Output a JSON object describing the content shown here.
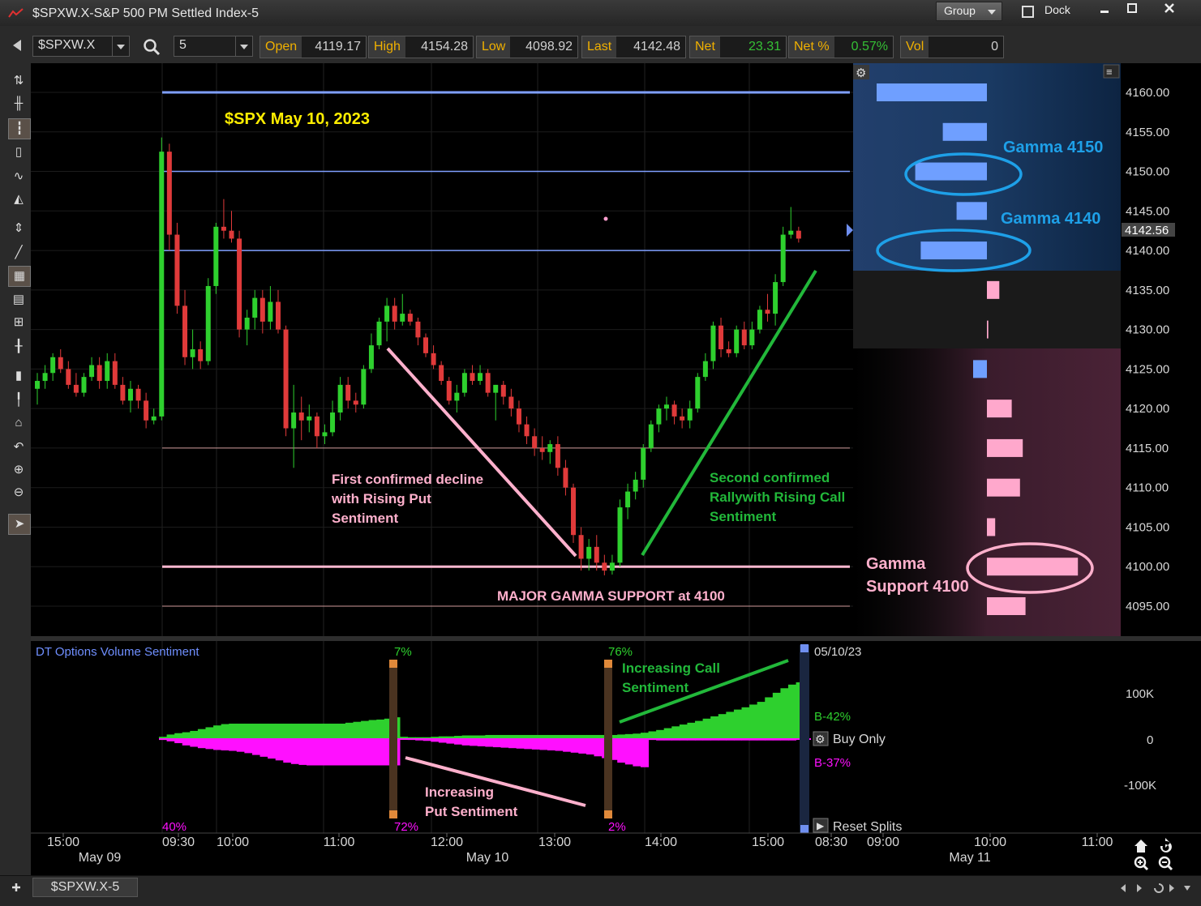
{
  "window": {
    "title": "$SPXW.X-S&P 500 PM Settled Index-5",
    "group_label": "Group",
    "dock_label": "Dock"
  },
  "toolbar": {
    "symbol": "$SPXW.X",
    "interval": "5",
    "quotes": [
      {
        "key": "Open",
        "value": "4119.17"
      },
      {
        "key": "High",
        "value": "4154.28"
      },
      {
        "key": "Low",
        "value": "4098.92"
      },
      {
        "key": "Last",
        "value": "4142.48"
      },
      {
        "key": "Net",
        "value": "23.31"
      },
      {
        "key": "Net %",
        "value": "0.57%"
      },
      {
        "key": "Vol",
        "value": "0"
      }
    ]
  },
  "chart": {
    "heading": "$SPX May 10, 2023",
    "price_axis_labels": [
      "4160.00",
      "4155.00",
      "4150.00",
      "4145.00",
      "4140.00",
      "4135.00",
      "4130.00",
      "4125.00",
      "4120.00",
      "4115.00",
      "4110.00",
      "4105.00",
      "4100.00",
      "4095.00"
    ],
    "current_price": "4142.56",
    "annotations": {
      "gamma_4150": "Gamma 4150",
      "gamma_4140": "Gamma 4140",
      "gamma_support_line1": "Gamma",
      "gamma_support_line2": "Support 4100",
      "decline_line1": "First confirmed decline",
      "decline_line2": "with Rising Put",
      "decline_line3": "Sentiment",
      "rally_line1": "Second confirmed",
      "rally_line2": "Rallywith Rising Call",
      "rally_line3": "Sentiment",
      "major_support": "MAJOR GAMMA SUPPORT at 4100"
    }
  },
  "indicator": {
    "title": "DT Options Volume Sentiment",
    "axis_labels": [
      "100K",
      "0",
      "-100K"
    ],
    "date_label": "05/10/23",
    "b_green": "B-42%",
    "b_magenta": "B-37%",
    "buy_only": "Buy Only",
    "reset_splits": "Reset Splits",
    "split_top": [
      "7%",
      "76%"
    ],
    "split_bottom": [
      "40%",
      "72%",
      "2%"
    ],
    "call_annotation_line1": "Increasing Call",
    "call_annotation_line2": "Sentiment",
    "put_annotation_line1": "Increasing",
    "put_annotation_line2": "Put Sentiment"
  },
  "time_axis": {
    "ticks": [
      "15:00",
      "09:30",
      "10:00",
      "11:00",
      "12:00",
      "13:00",
      "14:00",
      "15:00",
      "08:30",
      "09:00",
      "10:00",
      "11:00"
    ],
    "dates": [
      "May 09",
      "May 10",
      "May 11"
    ]
  },
  "bottom": {
    "tab": "$SPXW.X-5"
  },
  "chart_data": {
    "type": "candlestick",
    "title": "$SPX May 10, 2023",
    "y_range": [
      4092,
      4163
    ],
    "horizontal_levels": [
      4160,
      4150,
      4140,
      4115,
      4100,
      4095
    ],
    "candles": [
      {
        "o": 4122.5,
        "h": 4124.5,
        "l": 4120.5,
        "c": 4123.5
      },
      {
        "o": 4123.5,
        "h": 4125.5,
        "l": 4122.5,
        "c": 4124.5
      },
      {
        "o": 4124.5,
        "h": 4127,
        "l": 4123.5,
        "c": 4126.5
      },
      {
        "o": 4126.5,
        "h": 4127.5,
        "l": 4124.5,
        "c": 4125
      },
      {
        "o": 4125,
        "h": 4126,
        "l": 4122.5,
        "c": 4123
      },
      {
        "o": 4123,
        "h": 4124.5,
        "l": 4121.5,
        "c": 4122
      },
      {
        "o": 4122,
        "h": 4124.5,
        "l": 4121.5,
        "c": 4124
      },
      {
        "o": 4124,
        "h": 4126.5,
        "l": 4123.5,
        "c": 4125.5
      },
      {
        "o": 4125.5,
        "h": 4126.5,
        "l": 4122.5,
        "c": 4123.5
      },
      {
        "o": 4123.5,
        "h": 4127,
        "l": 4122.5,
        "c": 4126
      },
      {
        "o": 4126,
        "h": 4127,
        "l": 4122.5,
        "c": 4123
      },
      {
        "o": 4123,
        "h": 4124,
        "l": 4120.5,
        "c": 4121
      },
      {
        "o": 4121,
        "h": 4123.5,
        "l": 4119.5,
        "c": 4122.5
      },
      {
        "o": 4122.5,
        "h": 4123,
        "l": 4120,
        "c": 4121
      },
      {
        "o": 4121,
        "h": 4122,
        "l": 4117.5,
        "c": 4118.5
      },
      {
        "o": 4118.5,
        "h": 4120,
        "l": 4118,
        "c": 4119
      },
      {
        "o": 4119,
        "h": 4154.3,
        "l": 4118.5,
        "c": 4152.5
      },
      {
        "o": 4152.5,
        "h": 4153.5,
        "l": 4140,
        "c": 4142
      },
      {
        "o": 4142,
        "h": 4143.5,
        "l": 4132,
        "c": 4133
      },
      {
        "o": 4133,
        "h": 4135,
        "l": 4125.5,
        "c": 4126.5
      },
      {
        "o": 4126.5,
        "h": 4130,
        "l": 4125,
        "c": 4127.5
      },
      {
        "o": 4127.5,
        "h": 4128.5,
        "l": 4125,
        "c": 4126
      },
      {
        "o": 4126,
        "h": 4136.5,
        "l": 4125.5,
        "c": 4135.5
      },
      {
        "o": 4135.5,
        "h": 4143.5,
        "l": 4134.5,
        "c": 4143
      },
      {
        "o": 4143,
        "h": 4146.5,
        "l": 4141.5,
        "c": 4142.5
      },
      {
        "o": 4142.5,
        "h": 4145,
        "l": 4141,
        "c": 4141.5
      },
      {
        "o": 4141.5,
        "h": 4142.5,
        "l": 4129,
        "c": 4130
      },
      {
        "o": 4130,
        "h": 4132.5,
        "l": 4128,
        "c": 4131.5
      },
      {
        "o": 4131.5,
        "h": 4135,
        "l": 4130,
        "c": 4134
      },
      {
        "o": 4134,
        "h": 4135,
        "l": 4129.5,
        "c": 4131
      },
      {
        "o": 4131,
        "h": 4135.5,
        "l": 4130,
        "c": 4133.5
      },
      {
        "o": 4133.5,
        "h": 4135,
        "l": 4129.5,
        "c": 4130
      },
      {
        "o": 4130,
        "h": 4130.5,
        "l": 4116.5,
        "c": 4117.5
      },
      {
        "o": 4117.5,
        "h": 4123,
        "l": 4112.5,
        "c": 4119.5
      },
      {
        "o": 4119.5,
        "h": 4121.5,
        "l": 4116,
        "c": 4118.5
      },
      {
        "o": 4118.5,
        "h": 4120.5,
        "l": 4117,
        "c": 4119
      },
      {
        "o": 4119,
        "h": 4119.5,
        "l": 4115,
        "c": 4116.5
      },
      {
        "o": 4116.5,
        "h": 4118,
        "l": 4115.5,
        "c": 4117
      },
      {
        "o": 4117,
        "h": 4121,
        "l": 4116.5,
        "c": 4119.5
      },
      {
        "o": 4119.5,
        "h": 4124,
        "l": 4118.5,
        "c": 4123
      },
      {
        "o": 4123,
        "h": 4124,
        "l": 4120,
        "c": 4121
      },
      {
        "o": 4121,
        "h": 4122,
        "l": 4119.5,
        "c": 4120.5
      },
      {
        "o": 4120.5,
        "h": 4125.5,
        "l": 4120,
        "c": 4125
      },
      {
        "o": 4125,
        "h": 4129.5,
        "l": 4124.5,
        "c": 4128
      },
      {
        "o": 4128,
        "h": 4131.5,
        "l": 4127.5,
        "c": 4131
      },
      {
        "o": 4131,
        "h": 4134,
        "l": 4128.5,
        "c": 4133
      },
      {
        "o": 4133,
        "h": 4134,
        "l": 4130,
        "c": 4131
      },
      {
        "o": 4131,
        "h": 4134.5,
        "l": 4130.5,
        "c": 4132
      },
      {
        "o": 4132,
        "h": 4132.5,
        "l": 4130.5,
        "c": 4131
      },
      {
        "o": 4131,
        "h": 4131.5,
        "l": 4128,
        "c": 4129
      },
      {
        "o": 4129,
        "h": 4129.5,
        "l": 4126.5,
        "c": 4127
      },
      {
        "o": 4127,
        "h": 4128,
        "l": 4125,
        "c": 4125.5
      },
      {
        "o": 4125.5,
        "h": 4126,
        "l": 4123,
        "c": 4123.5
      },
      {
        "o": 4123.5,
        "h": 4124,
        "l": 4120.5,
        "c": 4121
      },
      {
        "o": 4121,
        "h": 4123,
        "l": 4119.5,
        "c": 4122
      },
      {
        "o": 4122,
        "h": 4125,
        "l": 4121.5,
        "c": 4124.5
      },
      {
        "o": 4124.5,
        "h": 4125.5,
        "l": 4123,
        "c": 4123.5
      },
      {
        "o": 4123.5,
        "h": 4125.5,
        "l": 4123,
        "c": 4124.5
      },
      {
        "o": 4124.5,
        "h": 4125,
        "l": 4121.5,
        "c": 4122
      },
      {
        "o": 4122,
        "h": 4123,
        "l": 4118.5,
        "c": 4123
      },
      {
        "o": 4123,
        "h": 4123.5,
        "l": 4120.5,
        "c": 4121.5
      },
      {
        "o": 4121.5,
        "h": 4122.5,
        "l": 4119,
        "c": 4120
      },
      {
        "o": 4120,
        "h": 4121,
        "l": 4117,
        "c": 4118
      },
      {
        "o": 4118,
        "h": 4119,
        "l": 4115.5,
        "c": 4116.5
      },
      {
        "o": 4116.5,
        "h": 4117.5,
        "l": 4114,
        "c": 4115
      },
      {
        "o": 4115,
        "h": 4116.5,
        "l": 4113.5,
        "c": 4114.5
      },
      {
        "o": 4114.5,
        "h": 4116,
        "l": 4113,
        "c": 4115.5
      },
      {
        "o": 4115.5,
        "h": 4116.5,
        "l": 4111.5,
        "c": 4112.5
      },
      {
        "o": 4112.5,
        "h": 4113.5,
        "l": 4109,
        "c": 4110
      },
      {
        "o": 4110,
        "h": 4110.5,
        "l": 4103,
        "c": 4104
      },
      {
        "o": 4104,
        "h": 4105,
        "l": 4099.5,
        "c": 4101
      },
      {
        "o": 4101,
        "h": 4103.5,
        "l": 4099.5,
        "c": 4102.5
      },
      {
        "o": 4102.5,
        "h": 4104,
        "l": 4099.5,
        "c": 4100.5
      },
      {
        "o": 4100.5,
        "h": 4101.5,
        "l": 4098.9,
        "c": 4099.5
      },
      {
        "o": 4099.5,
        "h": 4101.5,
        "l": 4099,
        "c": 4100.5
      },
      {
        "o": 4100.5,
        "h": 4108.5,
        "l": 4100,
        "c": 4107.5
      },
      {
        "o": 4107.5,
        "h": 4110.5,
        "l": 4106,
        "c": 4109.5
      },
      {
        "o": 4109.5,
        "h": 4112,
        "l": 4108.5,
        "c": 4111
      },
      {
        "o": 4111,
        "h": 4115.5,
        "l": 4110,
        "c": 4115
      },
      {
        "o": 4115,
        "h": 4118.5,
        "l": 4114.5,
        "c": 4118
      },
      {
        "o": 4118,
        "h": 4120.5,
        "l": 4117,
        "c": 4120
      },
      {
        "o": 4120,
        "h": 4121.5,
        "l": 4118.5,
        "c": 4120.5
      },
      {
        "o": 4120.5,
        "h": 4121,
        "l": 4118,
        "c": 4119
      },
      {
        "o": 4119,
        "h": 4120,
        "l": 4117.5,
        "c": 4118.5
      },
      {
        "o": 4118.5,
        "h": 4121,
        "l": 4117.5,
        "c": 4120
      },
      {
        "o": 4120,
        "h": 4124.5,
        "l": 4119.5,
        "c": 4124
      },
      {
        "o": 4124,
        "h": 4127,
        "l": 4123.5,
        "c": 4126
      },
      {
        "o": 4126,
        "h": 4131,
        "l": 4125,
        "c": 4130.5
      },
      {
        "o": 4130.5,
        "h": 4131.5,
        "l": 4126.5,
        "c": 4127.5
      },
      {
        "o": 4127.5,
        "h": 4128.5,
        "l": 4126.5,
        "c": 4127
      },
      {
        "o": 4127,
        "h": 4130.5,
        "l": 4126.5,
        "c": 4130
      },
      {
        "o": 4130,
        "h": 4131,
        "l": 4127.5,
        "c": 4128
      },
      {
        "o": 4128,
        "h": 4131,
        "l": 4127.5,
        "c": 4130
      },
      {
        "o": 4130,
        "h": 4133,
        "l": 4129.5,
        "c": 4132.5
      },
      {
        "o": 4132.5,
        "h": 4134.5,
        "l": 4131,
        "c": 4132
      },
      {
        "o": 4132,
        "h": 4137,
        "l": 4130.5,
        "c": 4136
      },
      {
        "o": 4136,
        "h": 4143,
        "l": 4135.5,
        "c": 4142
      },
      {
        "o": 4142,
        "h": 4145.5,
        "l": 4141.5,
        "c": 4142.5
      },
      {
        "o": 4142.5,
        "h": 4143,
        "l": 4141,
        "c": 4141.5
      }
    ],
    "gamma_profile": [
      {
        "strike": 4160,
        "side": "call",
        "size": 4.0
      },
      {
        "strike": 4155,
        "side": "call",
        "size": 1.6
      },
      {
        "strike": 4150,
        "side": "call",
        "size": 2.6
      },
      {
        "strike": 4145,
        "side": "call",
        "size": 1.1
      },
      {
        "strike": 4140,
        "side": "call",
        "size": 2.4
      },
      {
        "strike": 4135,
        "side": "put",
        "size": 0.45
      },
      {
        "strike": 4130,
        "side": "put",
        "size": 0.05
      },
      {
        "strike": 4125,
        "side": "call",
        "size": 0.5
      },
      {
        "strike": 4120,
        "side": "put",
        "size": 0.9
      },
      {
        "strike": 4115,
        "side": "put",
        "size": 1.3
      },
      {
        "strike": 4110,
        "side": "put",
        "size": 1.2
      },
      {
        "strike": 4105,
        "side": "put",
        "size": 0.3
      },
      {
        "strike": 4100,
        "side": "put",
        "size": 3.3
      },
      {
        "strike": 4095,
        "side": "put",
        "size": 1.4
      }
    ],
    "sentiment": {
      "y_range": [
        -160,
        160
      ],
      "call_buy": [
        5,
        10,
        13,
        15,
        18,
        22,
        26,
        30,
        33,
        34,
        34,
        34,
        34,
        34,
        34,
        34,
        34,
        34,
        34,
        34,
        34,
        34,
        34,
        34,
        36,
        38,
        40,
        42,
        43,
        45,
        48,
        5,
        4,
        4,
        4,
        5,
        6,
        6,
        7,
        8,
        8,
        8,
        9,
        9,
        9,
        9,
        9,
        9,
        9,
        9,
        9,
        9,
        9,
        9,
        9,
        9,
        9,
        9,
        9,
        10,
        11,
        12,
        14,
        17,
        20,
        24,
        28,
        32,
        36,
        40,
        45,
        50,
        55,
        60,
        65,
        70,
        76,
        82,
        92,
        102,
        112,
        120,
        125
      ],
      "put_buy": [
        -2,
        -5,
        -9,
        -14,
        -17,
        -20,
        -22,
        -24,
        -25,
        -26,
        -28,
        -31,
        -35,
        -39,
        -43,
        -47,
        -52,
        -55,
        -57,
        -58,
        -58,
        -58,
        -58,
        -58,
        -58,
        -58,
        -58,
        -58,
        -58,
        -58,
        -58,
        -1,
        -2,
        -3,
        -4,
        -6,
        -8,
        -10,
        -12,
        -14,
        -15,
        -16,
        -17,
        -18,
        -19,
        -20,
        -21,
        -22,
        -23,
        -24,
        -25,
        -26,
        -28,
        -30,
        -32,
        -34,
        -38,
        -42,
        -46,
        -52,
        -56,
        -60,
        -62,
        -2,
        -3,
        -3,
        -3,
        -3,
        -3,
        -3,
        -3,
        -3,
        -3,
        -3,
        -3,
        -3,
        -3,
        -3,
        -3,
        -3,
        -3,
        -3
      ]
    }
  }
}
